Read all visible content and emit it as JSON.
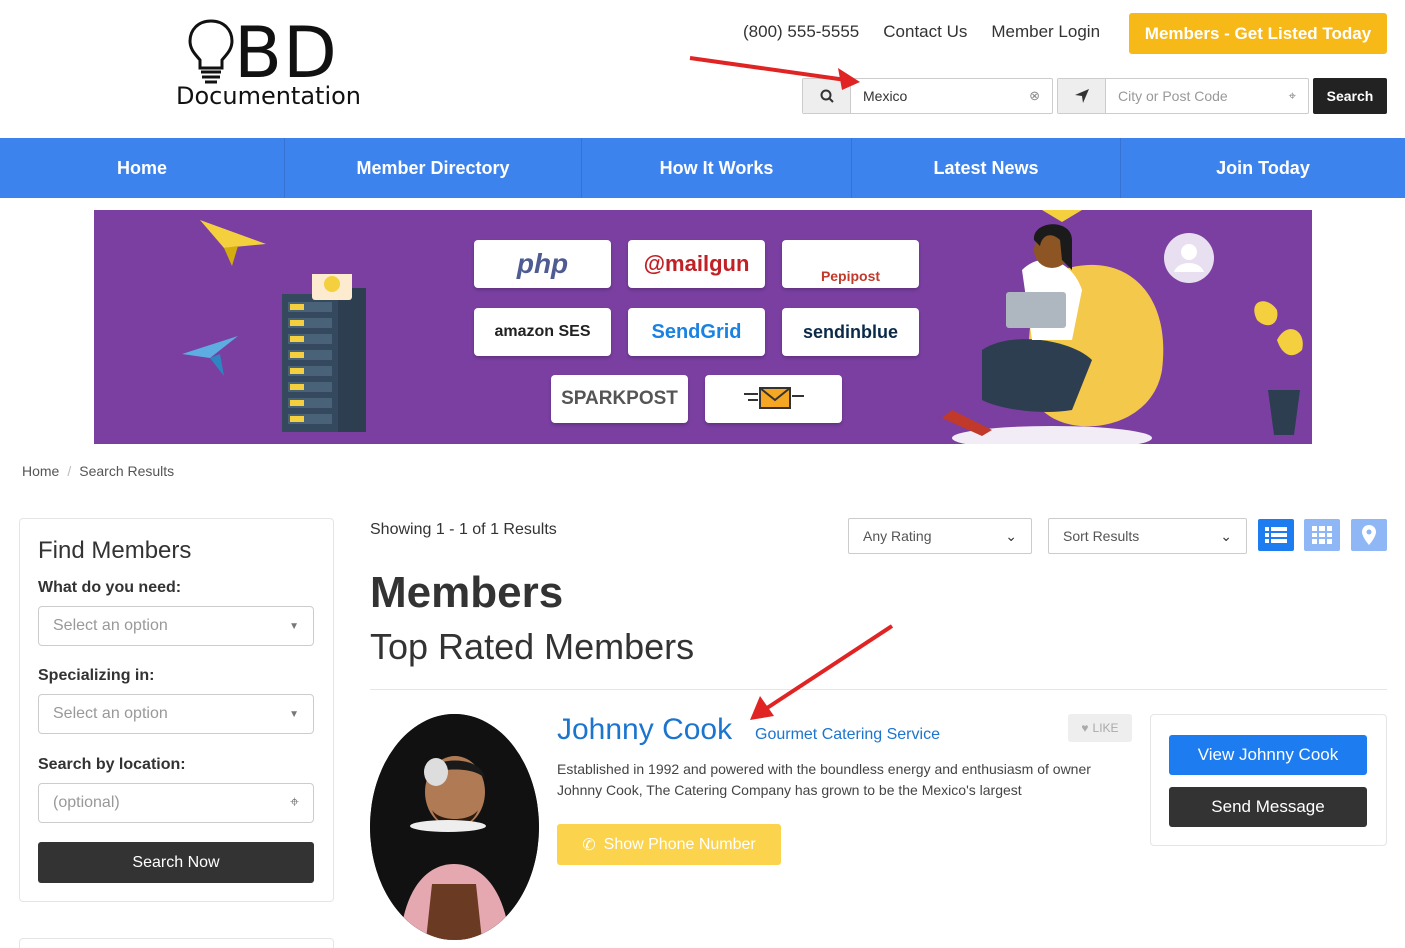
{
  "brand": {
    "logo_big": "BD",
    "logo_small": "Documentation"
  },
  "header": {
    "phone": "(800) 555-5555",
    "contact": "Contact Us",
    "login": "Member Login",
    "cta": "Members - Get Listed Today"
  },
  "search": {
    "keyword_value": "Mexico",
    "location_placeholder": "City or Post Code",
    "button": "Search"
  },
  "nav": [
    "Home",
    "Member Directory",
    "How It Works",
    "Latest News",
    "Join Today"
  ],
  "banner": {
    "logos": [
      "php",
      "@mailgun",
      "Pepipost",
      "amazon SES",
      "SendGrid",
      "sendinblue",
      "SPARKPOST"
    ]
  },
  "breadcrumb": {
    "home": "Home",
    "current": "Search Results"
  },
  "sidebar": {
    "title": "Find Members",
    "need_label": "What do you need:",
    "need_placeholder": "Select an option",
    "spec_label": "Specializing in:",
    "spec_placeholder": "Select an option",
    "loc_label": "Search by location:",
    "loc_placeholder": "(optional)",
    "button": "Search Now"
  },
  "results": {
    "showing": "Showing 1 - 1 of 1 Results",
    "rating_filter": "Any Rating",
    "sort": "Sort Results",
    "heading": "Members",
    "subheading": "Top Rated Members"
  },
  "member": {
    "name": "Johnny Cook",
    "category": "Gourmet Catering Service",
    "like": "LIKE",
    "description": "Established in 1992 and powered with the boundless energy and enthusiasm of owner Johnny Cook, The Catering Company has grown to be the Mexico's largest",
    "phone_button": "Show Phone Number",
    "view_button": "View Johnny Cook",
    "message_button": "Send Message"
  },
  "colors": {
    "nav": "#3d83ee",
    "cta": "#f7b918",
    "link": "#1b75cf",
    "banner": "#7a3fa1",
    "annotation_arrow": "#e02424"
  }
}
